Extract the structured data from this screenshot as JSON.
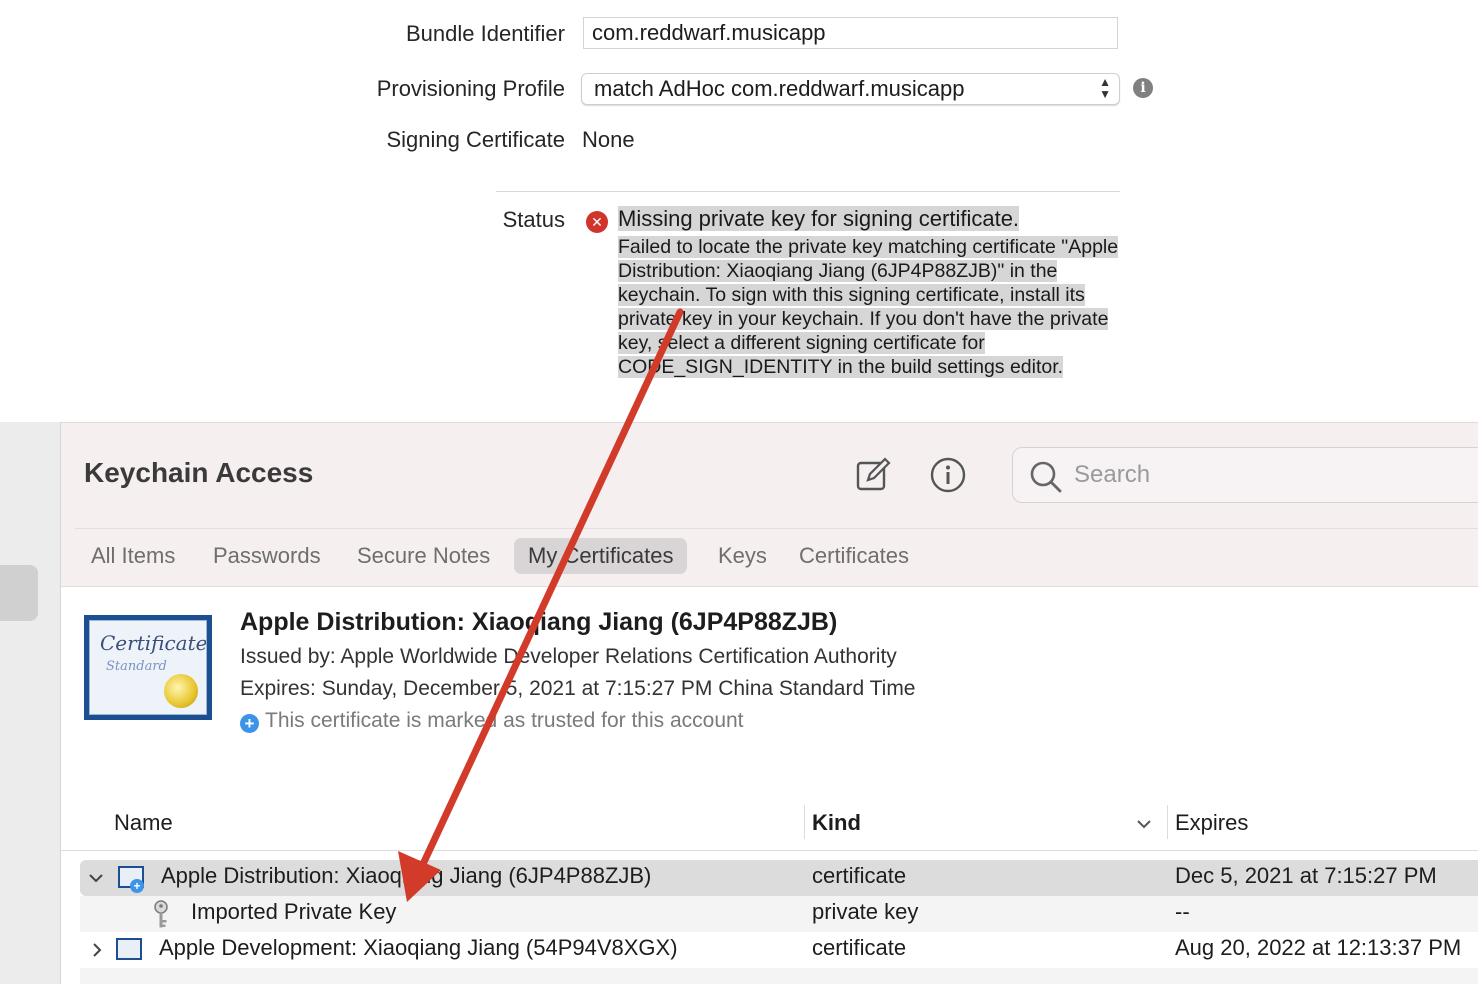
{
  "xcode": {
    "bundle_identifier_label": "Bundle Identifier",
    "bundle_identifier_value": "com.reddwarf.musicapp",
    "provisioning_profile_label": "Provisioning Profile",
    "provisioning_profile_value": "match AdHoc com.reddwarf.musicapp",
    "signing_certificate_label": "Signing Certificate",
    "signing_certificate_value": "None",
    "status_label": "Status",
    "status_title": "Missing private key for signing certificate.",
    "status_detail": "Failed to locate the private key matching certificate \"Apple Distribution: Xiaoqiang Jiang (6JP4P88ZJB)\" in the keychain. To sign with this signing certificate, install its private key in your keychain. If you don't have the private key, select a different signing certificate for CODE_SIGN_IDENTITY in the build settings editor.",
    "error_color": "#d0342c"
  },
  "keychain": {
    "app_title": "Keychain Access",
    "toolbar_icons": [
      "compose-icon",
      "info-icon",
      "search-icon"
    ],
    "search_placeholder": "Search",
    "tabs": [
      {
        "label": "All Items"
      },
      {
        "label": "Passwords"
      },
      {
        "label": "Secure Notes"
      },
      {
        "label": "My Certificates",
        "selected": true
      },
      {
        "label": "Keys"
      },
      {
        "label": "Certificates"
      }
    ],
    "cert_header": {
      "image_text_1": "Certificate",
      "image_text_2": "Standard",
      "name": "Apple Distribution: Xiaoqiang Jiang (6JP4P88ZJB)",
      "issued_by": "Issued by: Apple Worldwide Developer Relations Certification Authority",
      "expires": "Expires: Sunday, December 5, 2021 at 7:15:27 PM China Standard Time",
      "trust": "This certificate is marked as trusted for this account"
    },
    "table": {
      "columns": [
        "Name",
        "Kind",
        "Expires"
      ],
      "rows": [
        {
          "name": "Apple Distribution: Xiaoqiang Jiang (6JP4P88ZJB)",
          "kind": "certificate",
          "expires": "Dec 5, 2021 at 7:15:27 PM",
          "expanded": true,
          "selected": true
        },
        {
          "name": "Imported Private Key",
          "kind": "private key",
          "expires": "--",
          "child": true
        },
        {
          "name": "Apple Development: Xiaoqiang Jiang (54P94V8XGX)",
          "kind": "certificate",
          "expires": "Aug 20, 2022 at 12:13:37 PM",
          "expanded": false
        }
      ]
    }
  },
  "annotation": {
    "arrow_color": "#d23a2a"
  }
}
